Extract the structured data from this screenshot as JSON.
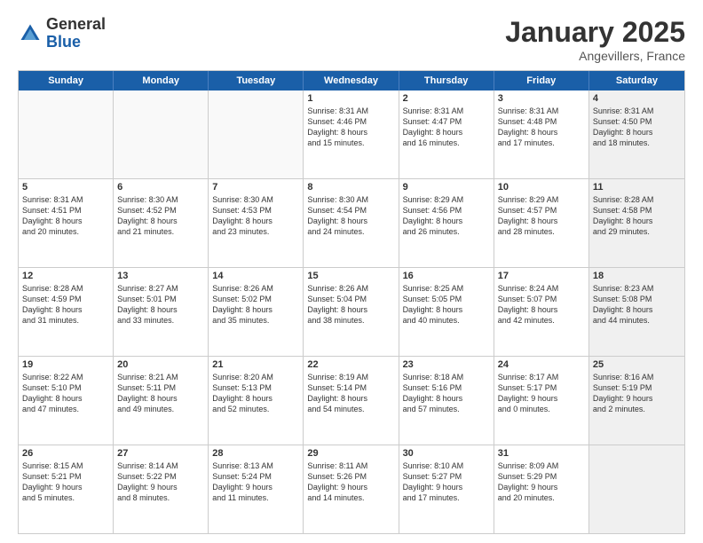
{
  "header": {
    "logo_general": "General",
    "logo_blue": "Blue",
    "title": "January 2025",
    "subtitle": "Angevillers, France"
  },
  "days_of_week": [
    "Sunday",
    "Monday",
    "Tuesday",
    "Wednesday",
    "Thursday",
    "Friday",
    "Saturday"
  ],
  "weeks": [
    [
      {
        "day": "",
        "empty": true
      },
      {
        "day": "",
        "empty": true
      },
      {
        "day": "",
        "empty": true
      },
      {
        "day": "1",
        "lines": [
          "Sunrise: 8:31 AM",
          "Sunset: 4:46 PM",
          "Daylight: 8 hours",
          "and 15 minutes."
        ]
      },
      {
        "day": "2",
        "lines": [
          "Sunrise: 8:31 AM",
          "Sunset: 4:47 PM",
          "Daylight: 8 hours",
          "and 16 minutes."
        ]
      },
      {
        "day": "3",
        "lines": [
          "Sunrise: 8:31 AM",
          "Sunset: 4:48 PM",
          "Daylight: 8 hours",
          "and 17 minutes."
        ]
      },
      {
        "day": "4",
        "lines": [
          "Sunrise: 8:31 AM",
          "Sunset: 4:50 PM",
          "Daylight: 8 hours",
          "and 18 minutes."
        ],
        "shaded": true
      }
    ],
    [
      {
        "day": "5",
        "lines": [
          "Sunrise: 8:31 AM",
          "Sunset: 4:51 PM",
          "Daylight: 8 hours",
          "and 20 minutes."
        ]
      },
      {
        "day": "6",
        "lines": [
          "Sunrise: 8:30 AM",
          "Sunset: 4:52 PM",
          "Daylight: 8 hours",
          "and 21 minutes."
        ]
      },
      {
        "day": "7",
        "lines": [
          "Sunrise: 8:30 AM",
          "Sunset: 4:53 PM",
          "Daylight: 8 hours",
          "and 23 minutes."
        ]
      },
      {
        "day": "8",
        "lines": [
          "Sunrise: 8:30 AM",
          "Sunset: 4:54 PM",
          "Daylight: 8 hours",
          "and 24 minutes."
        ]
      },
      {
        "day": "9",
        "lines": [
          "Sunrise: 8:29 AM",
          "Sunset: 4:56 PM",
          "Daylight: 8 hours",
          "and 26 minutes."
        ]
      },
      {
        "day": "10",
        "lines": [
          "Sunrise: 8:29 AM",
          "Sunset: 4:57 PM",
          "Daylight: 8 hours",
          "and 28 minutes."
        ]
      },
      {
        "day": "11",
        "lines": [
          "Sunrise: 8:28 AM",
          "Sunset: 4:58 PM",
          "Daylight: 8 hours",
          "and 29 minutes."
        ],
        "shaded": true
      }
    ],
    [
      {
        "day": "12",
        "lines": [
          "Sunrise: 8:28 AM",
          "Sunset: 4:59 PM",
          "Daylight: 8 hours",
          "and 31 minutes."
        ]
      },
      {
        "day": "13",
        "lines": [
          "Sunrise: 8:27 AM",
          "Sunset: 5:01 PM",
          "Daylight: 8 hours",
          "and 33 minutes."
        ]
      },
      {
        "day": "14",
        "lines": [
          "Sunrise: 8:26 AM",
          "Sunset: 5:02 PM",
          "Daylight: 8 hours",
          "and 35 minutes."
        ]
      },
      {
        "day": "15",
        "lines": [
          "Sunrise: 8:26 AM",
          "Sunset: 5:04 PM",
          "Daylight: 8 hours",
          "and 38 minutes."
        ]
      },
      {
        "day": "16",
        "lines": [
          "Sunrise: 8:25 AM",
          "Sunset: 5:05 PM",
          "Daylight: 8 hours",
          "and 40 minutes."
        ]
      },
      {
        "day": "17",
        "lines": [
          "Sunrise: 8:24 AM",
          "Sunset: 5:07 PM",
          "Daylight: 8 hours",
          "and 42 minutes."
        ]
      },
      {
        "day": "18",
        "lines": [
          "Sunrise: 8:23 AM",
          "Sunset: 5:08 PM",
          "Daylight: 8 hours",
          "and 44 minutes."
        ],
        "shaded": true
      }
    ],
    [
      {
        "day": "19",
        "lines": [
          "Sunrise: 8:22 AM",
          "Sunset: 5:10 PM",
          "Daylight: 8 hours",
          "and 47 minutes."
        ]
      },
      {
        "day": "20",
        "lines": [
          "Sunrise: 8:21 AM",
          "Sunset: 5:11 PM",
          "Daylight: 8 hours",
          "and 49 minutes."
        ]
      },
      {
        "day": "21",
        "lines": [
          "Sunrise: 8:20 AM",
          "Sunset: 5:13 PM",
          "Daylight: 8 hours",
          "and 52 minutes."
        ]
      },
      {
        "day": "22",
        "lines": [
          "Sunrise: 8:19 AM",
          "Sunset: 5:14 PM",
          "Daylight: 8 hours",
          "and 54 minutes."
        ]
      },
      {
        "day": "23",
        "lines": [
          "Sunrise: 8:18 AM",
          "Sunset: 5:16 PM",
          "Daylight: 8 hours",
          "and 57 minutes."
        ]
      },
      {
        "day": "24",
        "lines": [
          "Sunrise: 8:17 AM",
          "Sunset: 5:17 PM",
          "Daylight: 9 hours",
          "and 0 minutes."
        ]
      },
      {
        "day": "25",
        "lines": [
          "Sunrise: 8:16 AM",
          "Sunset: 5:19 PM",
          "Daylight: 9 hours",
          "and 2 minutes."
        ],
        "shaded": true
      }
    ],
    [
      {
        "day": "26",
        "lines": [
          "Sunrise: 8:15 AM",
          "Sunset: 5:21 PM",
          "Daylight: 9 hours",
          "and 5 minutes."
        ]
      },
      {
        "day": "27",
        "lines": [
          "Sunrise: 8:14 AM",
          "Sunset: 5:22 PM",
          "Daylight: 9 hours",
          "and 8 minutes."
        ]
      },
      {
        "day": "28",
        "lines": [
          "Sunrise: 8:13 AM",
          "Sunset: 5:24 PM",
          "Daylight: 9 hours",
          "and 11 minutes."
        ]
      },
      {
        "day": "29",
        "lines": [
          "Sunrise: 8:11 AM",
          "Sunset: 5:26 PM",
          "Daylight: 9 hours",
          "and 14 minutes."
        ]
      },
      {
        "day": "30",
        "lines": [
          "Sunrise: 8:10 AM",
          "Sunset: 5:27 PM",
          "Daylight: 9 hours",
          "and 17 minutes."
        ]
      },
      {
        "day": "31",
        "lines": [
          "Sunrise: 8:09 AM",
          "Sunset: 5:29 PM",
          "Daylight: 9 hours",
          "and 20 minutes."
        ]
      },
      {
        "day": "",
        "empty": true,
        "shaded": true
      }
    ]
  ]
}
